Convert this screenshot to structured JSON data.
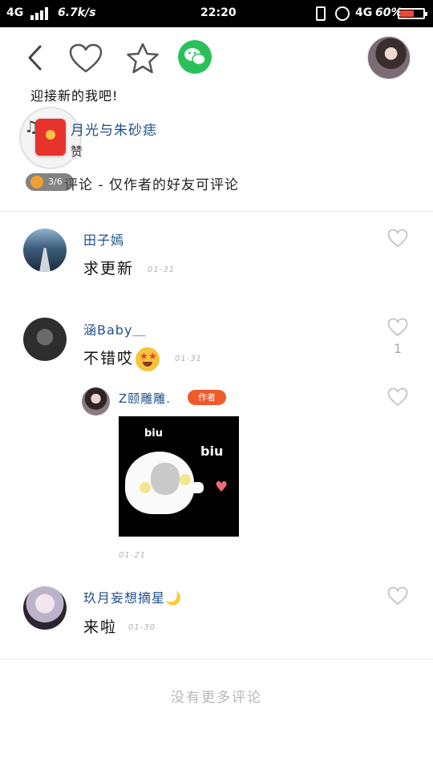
{
  "status_bar": {
    "network": "4G",
    "speed": "6.7k/s",
    "time": "22:20",
    "network2": "4G",
    "battery_pct": "60%",
    "battery_level": 0.6
  },
  "header": {
    "post_title": "迎接新的我吧!",
    "music_title": "月光与朱砂痣",
    "like_label": "赞",
    "reward_badge": "3/6",
    "comment_rule": "评论 - 仅作者的好友可评论"
  },
  "comments": [
    {
      "username": "田子嫣",
      "content": "求更新",
      "time": "01-31"
    },
    {
      "username": "涵Baby＿",
      "content": "不错哎",
      "time": "01-31",
      "likes": "1",
      "reply": {
        "username": "Z颐雕雕.",
        "tag": "作者",
        "sticker_text_1": "biu",
        "sticker_text_2": "biu",
        "time": "01-21"
      }
    },
    {
      "username": "玖月妄想摘星🌙",
      "content": "来啦",
      "time": "01-30"
    }
  ],
  "footer": {
    "no_more": "没有更多评论"
  },
  "colors": {
    "username": "#1f4f8a",
    "wechat": "#2bc15a",
    "author_tag": "#ef5a2b"
  }
}
